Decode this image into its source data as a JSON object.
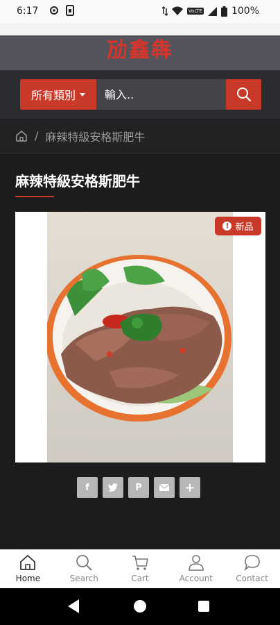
{
  "status_bar": {
    "time": "6:17",
    "battery": "100%",
    "icons": [
      "settings-gear-icon",
      "sim-card-icon",
      "data-arrows-icon",
      "wifi-icon",
      "volte-icon",
      "signal-icon",
      "battery-icon"
    ],
    "volte_label": "VoLTE"
  },
  "logo": {
    "text": "劢鑫犇"
  },
  "search": {
    "category_label": "所有類別",
    "placeholder": "輸入..",
    "icon": "search-icon"
  },
  "breadcrumb": {
    "home_icon": "home-icon",
    "separator": "/",
    "current": "麻辣特級安格斯肥牛"
  },
  "product": {
    "title": "麻辣特級安格斯肥牛",
    "badge": "新品",
    "image_alt": "spicy angus beef dish photo"
  },
  "share": {
    "facebook": "f",
    "twitter": "twitter-icon",
    "pinterest": "P",
    "email": "email-icon",
    "more": "+"
  },
  "bottom_nav": {
    "items": [
      {
        "label": "Home",
        "icon": "home-icon",
        "active": true
      },
      {
        "label": "Search",
        "icon": "search-icon",
        "active": false
      },
      {
        "label": "Cart",
        "icon": "cart-icon",
        "active": false
      },
      {
        "label": "Account",
        "icon": "account-icon",
        "active": false
      },
      {
        "label": "Contact",
        "icon": "chat-bubble-icon",
        "active": false
      }
    ]
  },
  "colors": {
    "accent": "#c8392a",
    "background": "#1c1c1e",
    "header": "#54545c"
  }
}
